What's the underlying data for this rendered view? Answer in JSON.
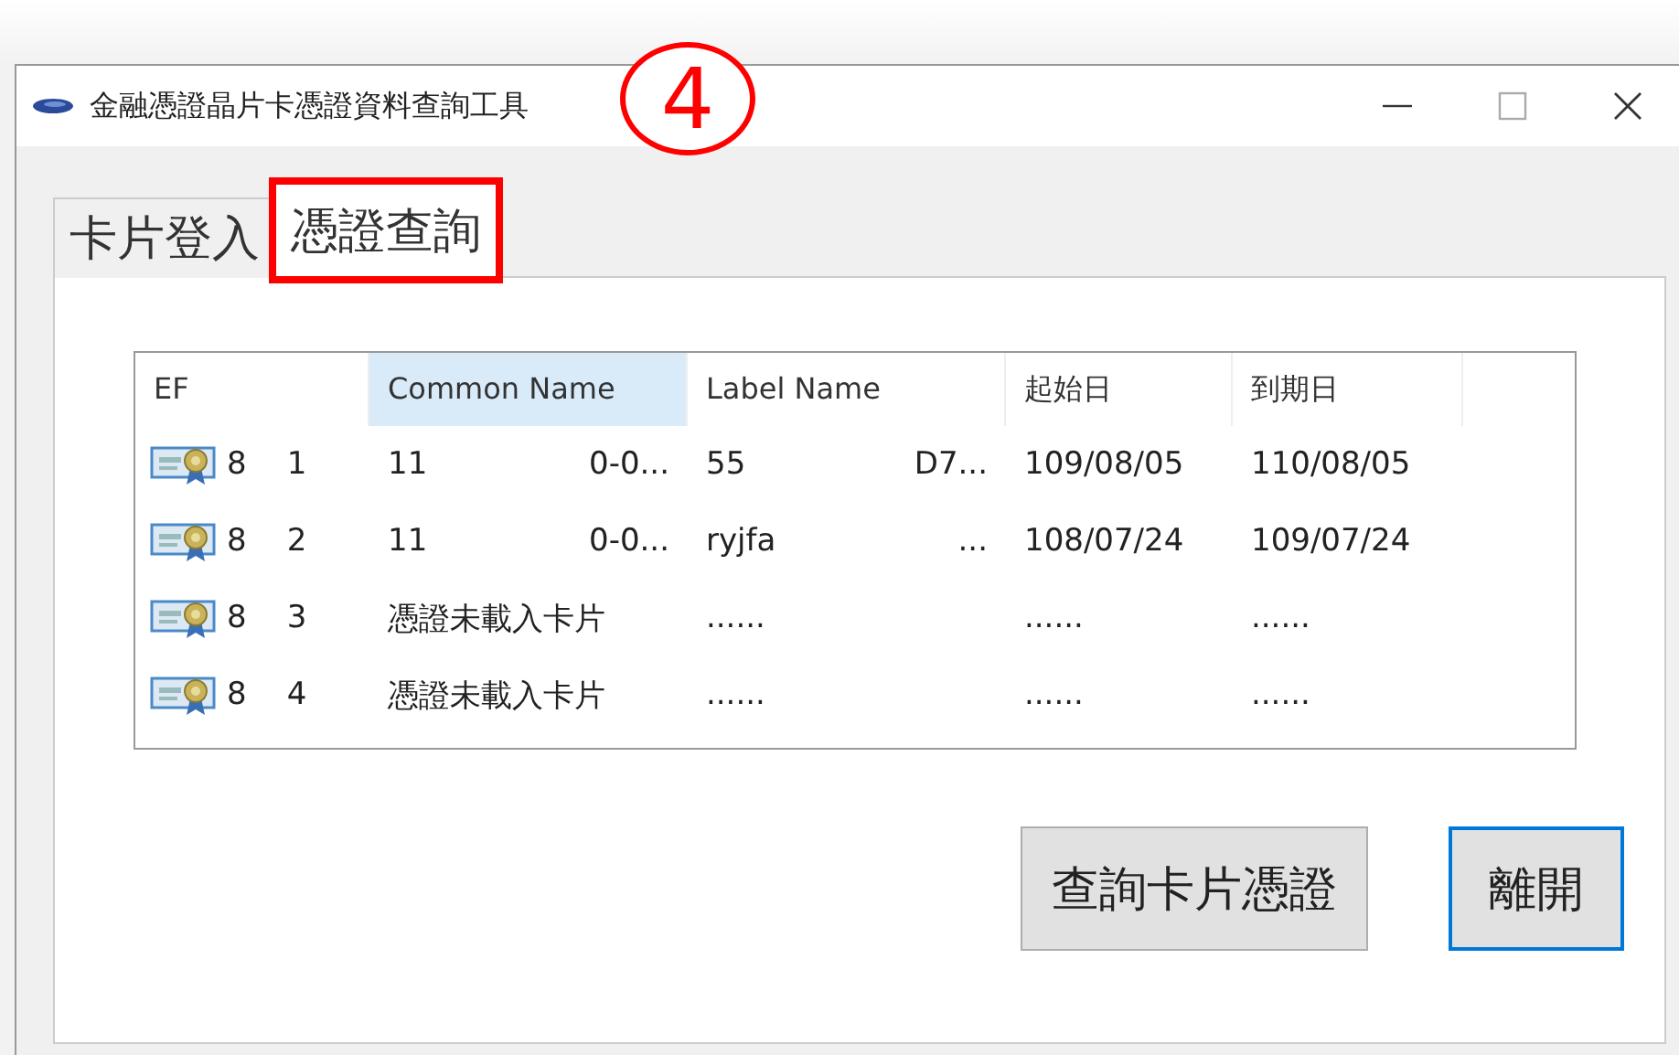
{
  "window": {
    "title": "金融憑證晶片卡憑證資料查詢工具"
  },
  "annotation": {
    "label": "4"
  },
  "tabs": [
    {
      "label": "卡片登入",
      "selected": false,
      "highlighted": false
    },
    {
      "label": "憑證查詢",
      "selected": true,
      "highlighted": true
    }
  ],
  "table": {
    "columns": [
      {
        "label": "EF",
        "selected": false
      },
      {
        "label": "Common Name",
        "selected": true
      },
      {
        "label": "Label Name",
        "selected": false
      },
      {
        "label": "起始日",
        "selected": false
      },
      {
        "label": "到期日",
        "selected": false
      }
    ],
    "rows": [
      {
        "ef": "8",
        "index": "1",
        "common_name": [
          "11",
          "0-0..."
        ],
        "label_name": [
          "55",
          "D7..."
        ],
        "start": "109/08/05",
        "end": "110/08/05"
      },
      {
        "ef": "8",
        "index": "2",
        "common_name": [
          "11",
          "0-0..."
        ],
        "label_name": [
          "ryjfa",
          "..."
        ],
        "start": "108/07/24",
        "end": "109/07/24"
      },
      {
        "ef": "8",
        "index": "3",
        "common_name": [
          "憑證未載入卡片"
        ],
        "label_name": [
          "......"
        ],
        "start": "......",
        "end": "......"
      },
      {
        "ef": "8",
        "index": "4",
        "common_name": [
          "憑證未載入卡片"
        ],
        "label_name": [
          "......"
        ],
        "start": "......",
        "end": "......"
      }
    ]
  },
  "buttons": [
    {
      "label": "查詢卡片憑證",
      "focused": false
    },
    {
      "label": "離開",
      "focused": true
    }
  ]
}
